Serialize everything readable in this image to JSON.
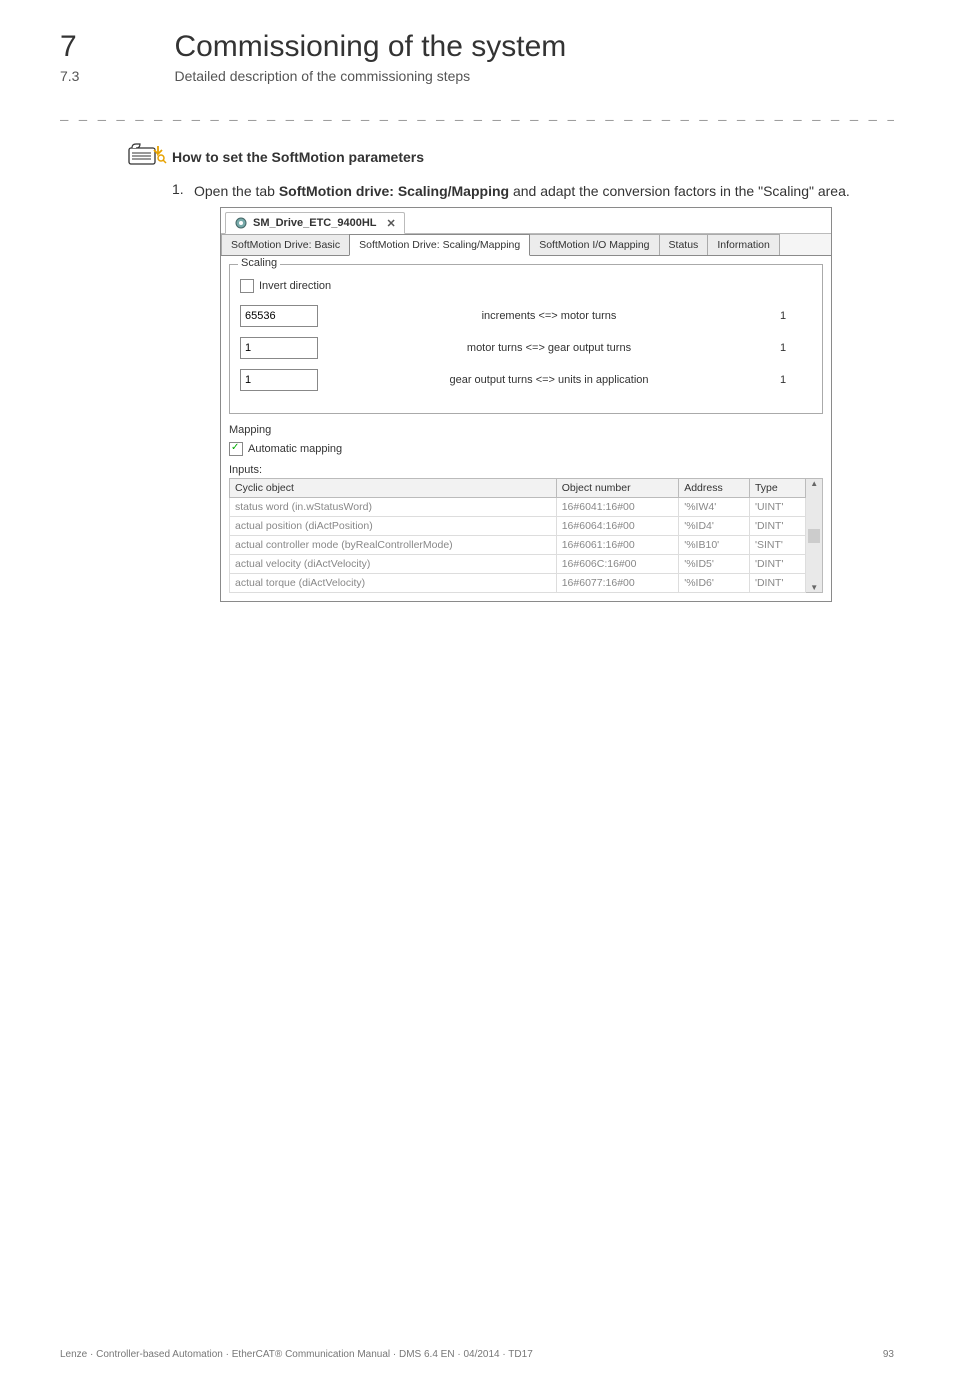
{
  "chapter": {
    "num": "7",
    "title": "Commissioning of the system",
    "subnum": "7.3",
    "subtitle": "Detailed description of the commissioning steps"
  },
  "separator": "_ _ _ _ _ _ _ _ _ _ _ _ _ _ _ _ _ _ _ _ _ _ _ _ _ _ _ _ _ _ _ _ _ _ _ _ _ _ _ _ _ _ _ _ _ _ _ _ _ _ _ _ _ _ _ _ _ _ _ _ _ _ _ _",
  "howto": {
    "title": "How to set the SoftMotion parameters"
  },
  "step": {
    "num": "1.",
    "text_pre": "Open the tab ",
    "text_bold": "SoftMotion drive: Scaling/Mapping",
    "text_post": " and adapt the conversion factors in the \"Scaling\" area."
  },
  "ss": {
    "filetab": "SM_Drive_ETC_9400HL",
    "tabs": [
      "SoftMotion Drive: Basic",
      "SoftMotion Drive: Scaling/Mapping",
      "SoftMotion I/O Mapping",
      "Status",
      "Information"
    ],
    "scaling": {
      "legend": "Scaling",
      "invert": "Invert direction",
      "rows": [
        {
          "left": "65536",
          "mid": "increments <=> motor turns",
          "right": "1"
        },
        {
          "left": "1",
          "mid": "motor turns <=> gear output turns",
          "right": "1"
        },
        {
          "left": "1",
          "mid": "gear output turns <=> units in application",
          "right": "1"
        }
      ]
    },
    "mapping": {
      "legend": "Mapping",
      "auto": "Automatic mapping",
      "inputs": "Inputs:"
    },
    "table": {
      "headers": [
        "Cyclic object",
        "Object number",
        "Address",
        "Type"
      ],
      "rows": [
        {
          "c": "status word (in.wStatusWord)",
          "o": "16#6041:16#00",
          "a": "'%IW4'",
          "t": "'UINT'"
        },
        {
          "c": "actual position (diActPosition)",
          "o": "16#6064:16#00",
          "a": "'%ID4'",
          "t": "'DINT'"
        },
        {
          "c": "actual controller mode (byRealControllerMode)",
          "o": "16#6061:16#00",
          "a": "'%IB10'",
          "t": "'SINT'"
        },
        {
          "c": "actual velocity (diActVelocity)",
          "o": "16#606C:16#00",
          "a": "'%ID5'",
          "t": "'DINT'"
        },
        {
          "c": "actual torque (diActVelocity)",
          "o": "16#6077:16#00",
          "a": "'%ID6'",
          "t": "'DINT'"
        }
      ]
    }
  },
  "footer": {
    "left": "Lenze · Controller-based Automation · EtherCAT® Communication Manual · DMS 6.4 EN · 04/2014 · TD17",
    "right": "93"
  }
}
